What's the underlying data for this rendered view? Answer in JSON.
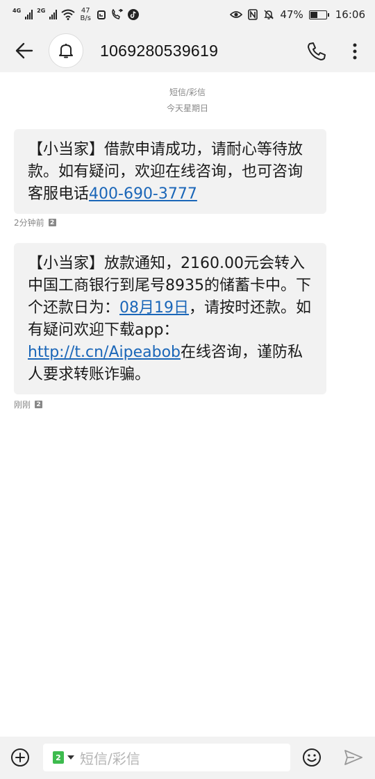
{
  "status_bar": {
    "sim1": "4G",
    "sim2": "2G",
    "speed_value": "47",
    "speed_unit": "B/s",
    "battery": "47%",
    "battery_level": 0.47,
    "time": "16:06"
  },
  "header": {
    "title": "1069280539619"
  },
  "thread": {
    "channel": "短信/彩信",
    "day": "今天星期日"
  },
  "messages": [
    {
      "text_before": "【小当家】借款申请成功，请耐心等待放款。如有疑问，欢迎在线咨询，也可咨询客服电话",
      "link1": "400-690-3777",
      "time": "2分钟前",
      "sim": "2"
    },
    {
      "text_a": "【小当家】放款通知，2160.00元会转入中国工商银行到尾号8935的储蓄卡中。下个还款日为：",
      "link_date": "08月19日",
      "text_b": "，请按时还款。如有疑问欢迎下载app：",
      "link_url": "http://t.cn/Aipeabob",
      "text_c": "在线咨询，谨防私人要求转账诈骗。",
      "time": "刚刚",
      "sim": "2"
    }
  ],
  "composer": {
    "sim": "2",
    "placeholder": "短信/彩信"
  },
  "colors": {
    "link": "#1a66b8",
    "sim_green": "#3dbb4e",
    "bar_bg": "#f2f2f2"
  }
}
